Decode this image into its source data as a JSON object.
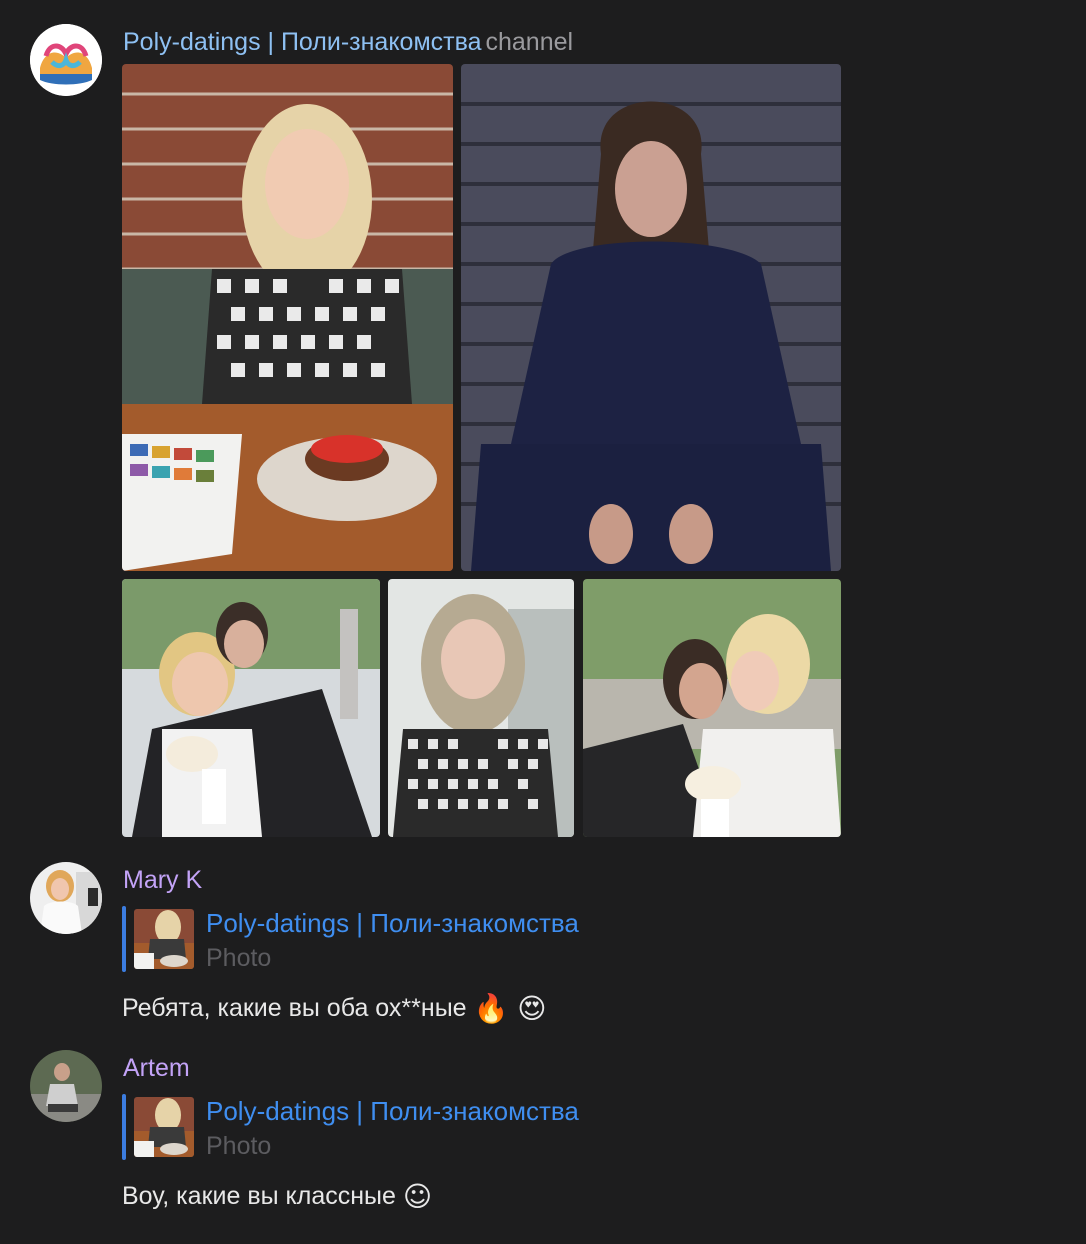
{
  "channel_post": {
    "avatar_icon": "infinity-heart-logo-icon",
    "sender_name": "Poly-datings | Поли-знакомства",
    "sender_suffix": "channel",
    "photos": [
      {
        "name": "photo-woman-checkered-dress-cafe"
      },
      {
        "name": "photo-man-long-hair-stairs"
      },
      {
        "name": "photo-couple-with-flowers"
      },
      {
        "name": "photo-woman-portrait-wall"
      },
      {
        "name": "photo-couple-embrace-park"
      }
    ]
  },
  "comments": [
    {
      "author": "Mary K",
      "reply_title": "Poly-datings | Поли-знакомства",
      "reply_sub": "Photo",
      "text": "Ребята, какие вы оба ох**ные",
      "emojis": "🔥 😍"
    },
    {
      "author": "Artem",
      "reply_title": "Poly-datings | Поли-знакомства",
      "reply_sub": "Photo",
      "text": "Воу, какие вы классные",
      "emojis": "☺"
    }
  ],
  "colors": {
    "background": "#1d1d1e",
    "channel_name": "#8ec0f2",
    "user_name": "#c3a3f7",
    "reply_accent": "#3c7de0",
    "reply_title": "#3f8ef0"
  }
}
